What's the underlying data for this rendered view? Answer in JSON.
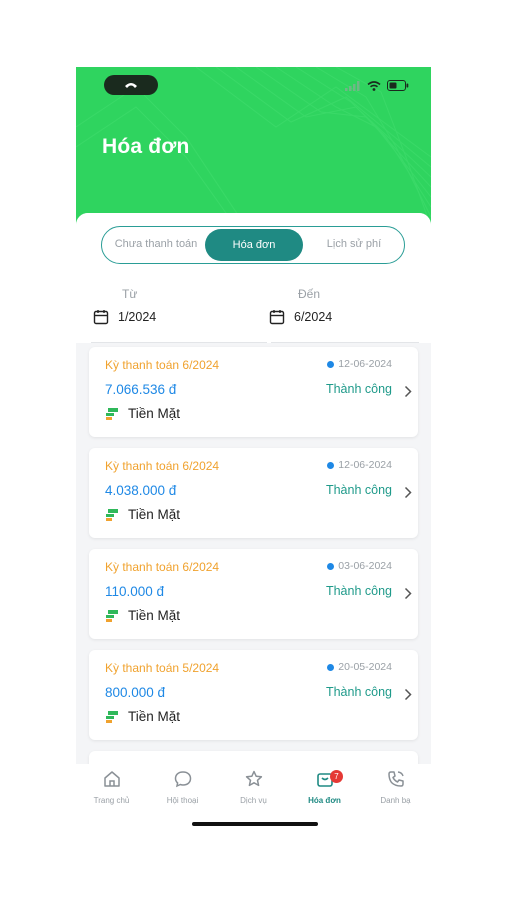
{
  "header": {
    "title": "Hóa đơn"
  },
  "tabs": [
    {
      "label": "Chưa thanh toán",
      "active": false
    },
    {
      "label": "Hóa đơn",
      "active": true
    },
    {
      "label": "Lịch sử phí",
      "active": false
    }
  ],
  "date_range": {
    "from_label": "Từ",
    "from_value": "1/2024",
    "to_label": "Đến",
    "to_value": "6/2024"
  },
  "invoices": [
    {
      "period": "Kỳ thanh toán 6/2024",
      "date": "12-06-2024",
      "amount": "7.066.536 đ",
      "status": "Thành công",
      "method": "Tiền Mặt"
    },
    {
      "period": "Kỳ thanh toán 6/2024",
      "date": "12-06-2024",
      "amount": "4.038.000 đ",
      "status": "Thành công",
      "method": "Tiền Mặt"
    },
    {
      "period": "Kỳ thanh toán 6/2024",
      "date": "03-06-2024",
      "amount": "110.000 đ",
      "status": "Thành công",
      "method": "Tiền Mặt"
    },
    {
      "period": "Kỳ thanh toán 5/2024",
      "date": "20-05-2024",
      "amount": "800.000 đ",
      "status": "Thành công",
      "method": "Tiền Mặt"
    }
  ],
  "bottom_nav": [
    {
      "label": "Trang chủ",
      "icon": "home-icon"
    },
    {
      "label": "Hội thoại",
      "icon": "chat-icon"
    },
    {
      "label": "Dịch vụ",
      "icon": "star-icon"
    },
    {
      "label": "Hóa đơn",
      "icon": "bag-icon",
      "badge": "7",
      "active": true
    },
    {
      "label": "Danh bạ",
      "icon": "phone-contacts-icon"
    }
  ],
  "colors": {
    "header": "#2fd45f",
    "accent": "#1f8a83",
    "period": "#f0a22e",
    "amount": "#1e88e5",
    "success": "#1f9a8a",
    "badge": "#e53935"
  }
}
